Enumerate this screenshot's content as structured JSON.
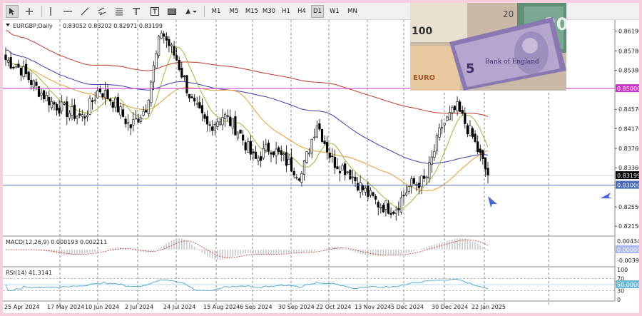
{
  "toolbar": {
    "timeframes": [
      "M1",
      "M5",
      "M15",
      "M30",
      "H1",
      "H4",
      "D1",
      "W1",
      "MN"
    ],
    "selected_timeframe": "D1"
  },
  "chart_header": {
    "symbol": "EURGBP,Daily",
    "ohlc": "0.83052 0.83202 0.82971 0.83199"
  },
  "price_axis": {
    "ticks": [
      "0.86190",
      "0.85780",
      "0.85380",
      "0.84570",
      "0.84170",
      "0.83760",
      "0.83360",
      "0.82550",
      "0.82150"
    ],
    "level_label": "0.85000",
    "current_price": "0.83199",
    "support_label": "0.83000"
  },
  "date_axis": {
    "ticks": [
      "25 Apr 2024",
      "17 May 2024",
      "10 Jun 2024",
      "2 Jul 2024",
      "24 Jul 2024",
      "15 Aug 2024",
      "6 Sep 2024",
      "30 Sep 2024",
      "22 Oct 2024",
      "13 Nov 2024",
      "5 Dec 2024",
      "30 Dec 2024",
      "22 Jan 2025"
    ]
  },
  "macd": {
    "label": "MACD(12,26,9) 0.000193 0.002211",
    "ticks": [
      "0.004344",
      "0.000000",
      "-0.003917"
    ]
  },
  "rsi": {
    "label": "RSI(14) 41.3141",
    "ticks": [
      "100",
      "70",
      "50.0000",
      "30",
      "0"
    ]
  },
  "colors": {
    "level_line": "#cc33cc",
    "support_line": "#4466bb",
    "ma_red": "#c0392b",
    "ma_blue": "#3b3bb0",
    "ma_orange": "#e69d2e",
    "ma_green": "#9fb53a",
    "macd_hist": "#c8c8c8",
    "macd_signal": "#c0392b",
    "rsi_line": "#4aa3c9",
    "arrow": "#4466dd"
  },
  "chart_data": {
    "type": "candlestick",
    "symbol": "EURGBP",
    "timeframe": "Daily",
    "ylim": [
      0.8196,
      0.8636
    ],
    "x": [
      "25 Apr 2024",
      "17 May 2024",
      "10 Jun 2024",
      "2 Jul 2024",
      "24 Jul 2024",
      "15 Aug 2024",
      "6 Sep 2024",
      "30 Sep 2024",
      "22 Oct 2024",
      "13 Nov 2024",
      "5 Dec 2024",
      "30 Dec 2024",
      "22 Jan 2025"
    ],
    "close_path": [
      0.856,
      0.854,
      0.85,
      0.847,
      0.8452,
      0.844,
      0.85,
      0.847,
      0.842,
      0.846,
      0.862,
      0.856,
      0.847,
      0.842,
      0.8445,
      0.841,
      0.835,
      0.838,
      0.835,
      0.832,
      0.843,
      0.835,
      0.833,
      0.829,
      0.826,
      0.825,
      0.83,
      0.831,
      0.842,
      0.846,
      0.84,
      0.832
    ],
    "horizontal_levels": [
      0.85,
      0.83
    ]
  }
}
